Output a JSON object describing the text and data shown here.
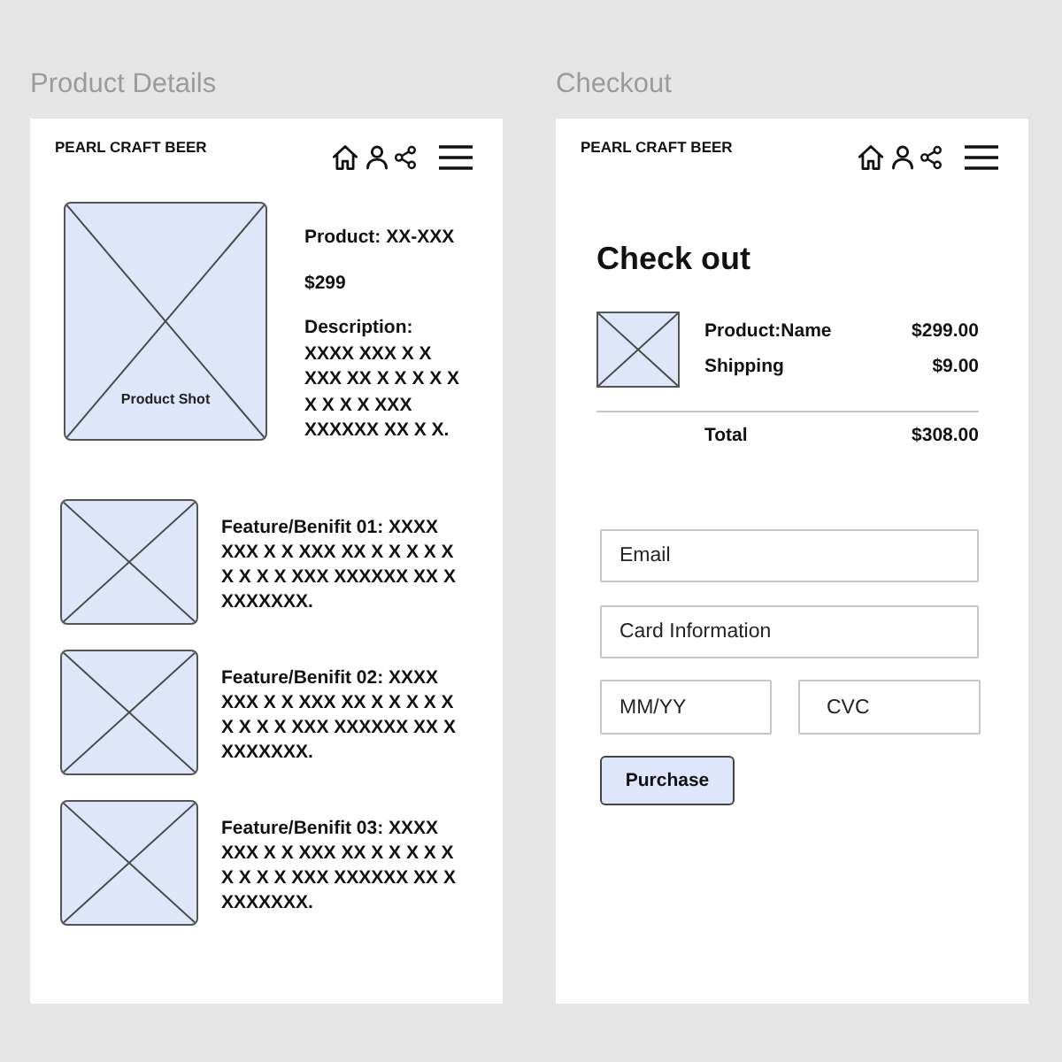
{
  "product_details": {
    "label": "Product Details",
    "brand": "PEARL CRAFT BEER",
    "product": {
      "image_caption": "Product Shot",
      "name": "Product: XX-XXX",
      "price": "$299",
      "description_label": "Description:",
      "description": "XXXX XXX X X XXX XX X X X X X X X X X XXX XXXXXX XX X X."
    },
    "features": [
      "Feature/Benifit 01: XXXX XXX X X XXX XX X X X X X X X X X XXX XXXXXX XX X XXXXXXX.",
      "Feature/Benifit 02: XXXX XXX X X XXX XX X X X X X X X X X XXX XXXXXX XX X XXXXXXX.",
      "Feature/Benifit 03: XXXX XXX X X XXX XX X X X X X X X X X XXX XXXXXX XX X XXXXXXX."
    ]
  },
  "checkout": {
    "label": "Checkout",
    "brand": "PEARL CRAFT BEER",
    "heading": "Check out",
    "lines": [
      {
        "label": "Product:Name",
        "amount": "$299.00"
      },
      {
        "label": "Shipping",
        "amount": "$9.00"
      }
    ],
    "total": {
      "label": "Total",
      "amount": "$308.00"
    },
    "fields": [
      {
        "placeholder": "Email"
      },
      {
        "placeholder": "Card Information"
      }
    ],
    "card_details": [
      {
        "placeholder": "MM/YY"
      },
      {
        "placeholder": "CVC"
      }
    ],
    "purchase_button": "Purchase"
  }
}
